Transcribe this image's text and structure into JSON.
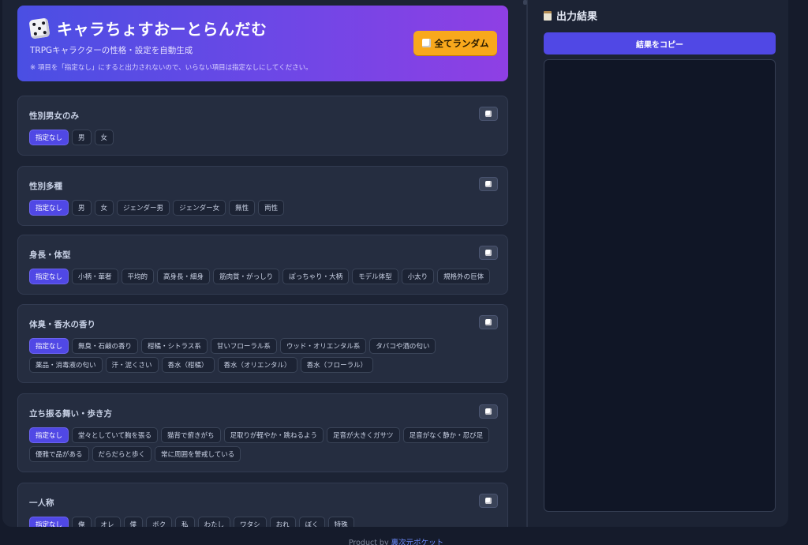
{
  "header": {
    "title": "キャラちょすおーとらんだむ",
    "subtitle": "TRPGキャラクターの性格・設定を自動生成",
    "note": "※ 項目を「指定なし」にすると出力されないので、いらない項目は指定なしにしてください。",
    "all_random_label": "全てランダム"
  },
  "sections": [
    {
      "title": "性別男女のみ",
      "options": [
        "指定なし",
        "男",
        "女"
      ],
      "selected": "指定なし"
    },
    {
      "title": "性別多種",
      "options": [
        "指定なし",
        "男",
        "女",
        "ジェンダー男",
        "ジェンダー女",
        "無性",
        "両性"
      ],
      "selected": "指定なし"
    },
    {
      "title": "身長・体型",
      "options": [
        "指定なし",
        "小柄・華奢",
        "平均的",
        "高身長・細身",
        "筋肉質・がっしり",
        "ぽっちゃり・大柄",
        "モデル体型",
        "小太り",
        "規格外の巨体"
      ],
      "selected": "指定なし"
    },
    {
      "title": "体臭・香水の香り",
      "options": [
        "指定なし",
        "無臭・石鹸の香り",
        "柑橘・シトラス系",
        "甘いフローラル系",
        "ウッド・オリエンタル系",
        "タバコや酒の匂い",
        "薬品・消毒液の匂い",
        "汗・泥くさい",
        "香水（柑橘）",
        "香水（オリエンタル）",
        "香水（フローラル）"
      ],
      "selected": "指定なし"
    },
    {
      "title": "立ち振る舞い・歩き方",
      "options": [
        "指定なし",
        "堂々としていて胸を張る",
        "猫背で俯きがち",
        "足取りが軽やか・跳ねるよう",
        "足音が大きくガサツ",
        "足音がなく静か・忍び足",
        "優雅で品がある",
        "だらだらと歩く",
        "常に周囲を警戒している"
      ],
      "selected": "指定なし"
    },
    {
      "title": "一人称",
      "options": [
        "指定なし",
        "俺",
        "オレ",
        "僕",
        "ボク",
        "私",
        "わたし",
        "ワタシ",
        "おれ",
        "ぼく",
        "特殊"
      ],
      "selected": "指定なし"
    }
  ],
  "output": {
    "title": "出力結果",
    "copy_label": "結果をコピー",
    "content": ""
  },
  "footer": {
    "prefix": "Product by",
    "link": "裏次元ポケット"
  }
}
